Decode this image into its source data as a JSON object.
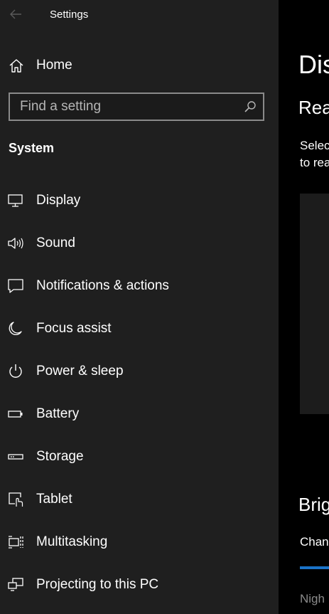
{
  "window": {
    "title": "Settings"
  },
  "sidebar": {
    "home_label": "Home",
    "search_placeholder": "Find a setting",
    "section_heading": "System",
    "items": [
      {
        "label": "Display",
        "icon": "display-icon"
      },
      {
        "label": "Sound",
        "icon": "sound-icon"
      },
      {
        "label": "Notifications & actions",
        "icon": "notifications-icon"
      },
      {
        "label": "Focus assist",
        "icon": "moon-icon"
      },
      {
        "label": "Power & sleep",
        "icon": "power-icon"
      },
      {
        "label": "Battery",
        "icon": "battery-icon"
      },
      {
        "label": "Storage",
        "icon": "storage-icon"
      },
      {
        "label": "Tablet",
        "icon": "tablet-icon"
      },
      {
        "label": "Multitasking",
        "icon": "multitasking-icon"
      },
      {
        "label": "Projecting to this PC",
        "icon": "projecting-icon"
      }
    ]
  },
  "main": {
    "page_title": "Dis",
    "subheading": "Rear",
    "description_line1": "Selec",
    "description_line2": "to rea",
    "brightness_heading": "Brig",
    "brightness_label": "Chan",
    "night_light_label": "Nigh"
  },
  "colors": {
    "sidebar_bg": "#1f1f1f",
    "main_bg": "#000000",
    "accent": "#1a73c8",
    "search_border": "#8a8a8a"
  }
}
